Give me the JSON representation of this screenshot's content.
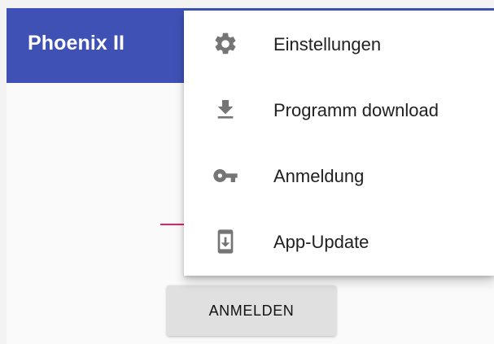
{
  "appbar": {
    "title": "Phoenix II",
    "background_color": "#3f51b5"
  },
  "main": {
    "login_button_label": "ANMELDEN",
    "underline_color": "#e91e63"
  },
  "overflow_menu": {
    "items": [
      {
        "label": "Einstellungen",
        "icon": "settings-icon"
      },
      {
        "label": "Programm download",
        "icon": "download-icon"
      },
      {
        "label": "Anmeldung",
        "icon": "key-icon"
      },
      {
        "label": "App-Update",
        "icon": "system-update-icon"
      }
    ]
  }
}
